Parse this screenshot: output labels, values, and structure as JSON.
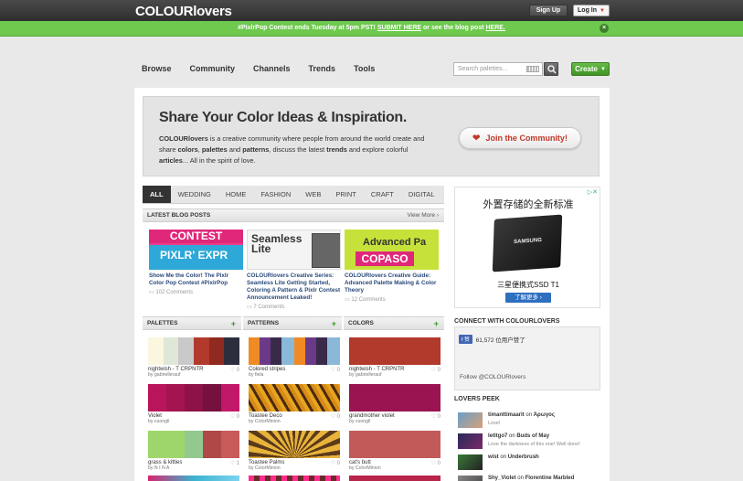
{
  "header": {
    "logo": "COLOURlovers",
    "signup_label": "Sign Up",
    "login_label": "Log In"
  },
  "promo": {
    "text_prefix": "#PixlrPop Contest ends Tuesday at 5pm PST!",
    "link_submit": "SUBMIT HERE",
    "text_middle": "or see the blog post",
    "link_here": "HERE.",
    "close": "×"
  },
  "nav": {
    "items": [
      "Browse",
      "Community",
      "Channels",
      "Trends",
      "Tools"
    ],
    "search_placeholder": "Search palettes...",
    "create_label": "Create"
  },
  "hero": {
    "title": "Share Your Color Ideas & Inspiration.",
    "brand": "COLOURlovers",
    "text1": " is a creative community where people from around the world create and share ",
    "b_colors": "colors",
    "text2": ", ",
    "b_palettes": "palettes",
    "text3": " and ",
    "b_patterns": "patterns",
    "text4": ", discuss the latest ",
    "b_trends": "trends",
    "text5": " and explore colorful ",
    "b_articles": "articles",
    "text6": "... All in the spirit of love.",
    "join_label": "Join the Community!"
  },
  "tabs": [
    "ALL",
    "WEDDING",
    "HOME",
    "FASHION",
    "WEB",
    "PRINT",
    "CRAFT",
    "DIGITAL ART"
  ],
  "blog": {
    "header": "LATEST BLOG POSTS",
    "more": "View More ›",
    "posts": [
      {
        "title": "Show Me the Color! The Pixlr Color Pop Contest #PixlrPop",
        "comments": "102 Comments",
        "thumb_a": "CONTEST",
        "thumb_b": "PIXLR' EXPR"
      },
      {
        "title": "COLOURlovers Creative Series: Seamless Lite Getting Started, Coloring A Pattern & Pixlr Contest Announcement Leaked!",
        "comments": "7 Comments",
        "thumb_a": "Seamless",
        "thumb_b": "Lite"
      },
      {
        "title": "COLOURlovers Creative Guide: Advanced Palette Making & Color Theory",
        "comments": "12 Comments",
        "thumb_a": "Advanced Pa",
        "thumb_b": "COPASO"
      }
    ]
  },
  "columns": {
    "palettes_label": "PALETTES",
    "patterns_label": "PATTERNS",
    "colors_label": "COLORS",
    "plus": "+",
    "palettes": [
      {
        "name": "nightwish - T CRPNTR",
        "by": "by gabriellerauf",
        "count": "0",
        "colors": [
          "#fbf6e0",
          "#dfe7d8",
          "#c9c9c9",
          "#b23a2c",
          "#8e2a20",
          "#2c2e3e"
        ]
      },
      {
        "name": "Violet",
        "by": "by cuongll",
        "count": "0",
        "colors": [
          "#b9155c",
          "#a31451",
          "#8d1248",
          "#76103f",
          "#c2186a"
        ]
      },
      {
        "name": "grass & kitties",
        "by": "by N I N A",
        "count": "1",
        "colors": [
          "#9ed66c",
          "#9ed66c",
          "#93c88f",
          "#b04848",
          "#c85a5a"
        ]
      }
    ],
    "patterns": [
      {
        "name": "Colored stripes",
        "by": "by fiela",
        "count": "0"
      },
      {
        "name": "Toastee Deco",
        "by": "by ColorMinion",
        "count": "0"
      },
      {
        "name": "Toastee Palms",
        "by": "by ColorMinion",
        "count": "0"
      }
    ],
    "colors": [
      {
        "name": "nightwish - T CRPNTR",
        "by": "by gabriellerauf",
        "count": "0",
        "color": "#b23a2c"
      },
      {
        "name": "grandmother violet",
        "by": "by cuongll",
        "count": "0",
        "color": "#9a1452"
      },
      {
        "name": "cat's butt",
        "by": "by ColorMinion",
        "count": "0",
        "color": "#c25a5a"
      }
    ]
  },
  "sidebar": {
    "ad_title": "外置存储的全新标准",
    "ad_brand": "SAMSUNG",
    "ad_sub": "三星便携式SSD T1",
    "ad_button": "了解更多 ›",
    "connect_header": "CONNECT WITH COLOURLOVERS",
    "fb_button": "赞",
    "fb_count": "61,572 位用户赞了",
    "follow": "Follow @COLOURlovers",
    "peek_header": "LOVERS PEEK",
    "peek": [
      {
        "user": "timanttimaarit",
        "action": " on ",
        "target": "Άρωγος",
        "msg": "Love!",
        "c1": "#6a9fc8",
        "c2": "#d5a07a"
      },
      {
        "user": "letitgo7",
        "action": " on ",
        "target": "Buds of May",
        "msg": "Love the darkness of this one! Well done!",
        "c1": "#2a2a5a",
        "c2": "#7a2a6a"
      },
      {
        "user": "wist",
        "action": " on ",
        "target": "Underbrush",
        "msg": "",
        "c1": "#3a7a3a",
        "c2": "#222"
      },
      {
        "user": "Shy_Violet",
        "action": " on ",
        "target": "Florentine Marbled",
        "msg": "",
        "c1": "#888",
        "c2": "#444"
      }
    ]
  }
}
